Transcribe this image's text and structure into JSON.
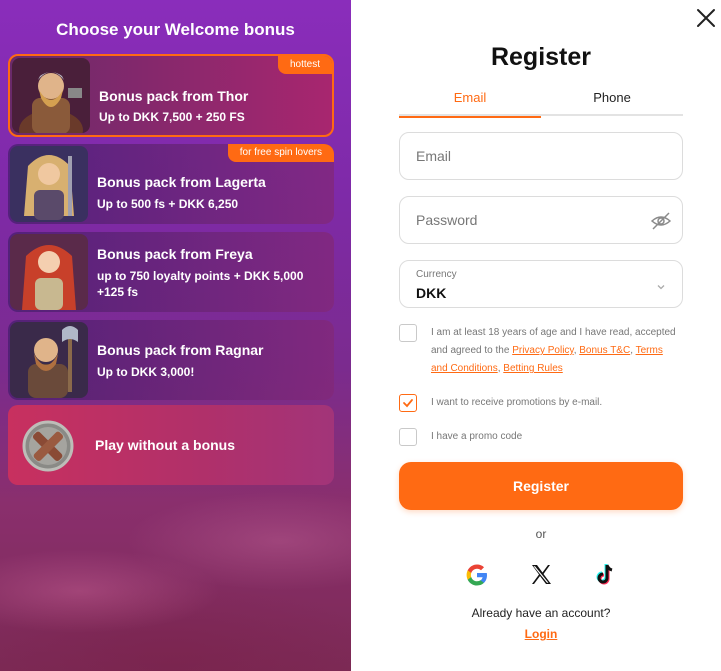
{
  "left": {
    "title": "Choose your Welcome bonus",
    "bonuses": [
      {
        "title": "Bonus pack from Thor",
        "subtitle": "Up to DKK 7,500 + 250 FS",
        "badge": "hottest",
        "selected": true
      },
      {
        "title": "Bonus pack from Lagerta",
        "subtitle": "Up to 500 fs + DKK 6,250",
        "badge": "for free spin lovers"
      },
      {
        "title": "Bonus pack from Freya",
        "subtitle": "up to 750 loyalty points + DKK 5,000 +125 fs"
      },
      {
        "title": "Bonus pack from Ragnar",
        "subtitle": "Up to DKK 3,000!"
      }
    ],
    "no_bonus_label": "Play without a bonus"
  },
  "register": {
    "title": "Register",
    "tabs": [
      {
        "label": "Email",
        "active": true
      },
      {
        "label": "Phone",
        "active": false
      }
    ],
    "email_placeholder": "Email",
    "password_placeholder": "Password",
    "currency_label": "Currency",
    "currency_value": "DKK",
    "age_text": "I am at least 18 years of age and I have read, accepted and agreed to the",
    "links": {
      "privacy": "Privacy Policy",
      "bonus": "Bonus T&C",
      "terms": "Terms and Conditions",
      "betting": "Betting Rules"
    },
    "age_checked": false,
    "promotions_text": "I want to receive promotions by e-mail.",
    "promotions_checked": true,
    "promo_code_text": "I have a promo code",
    "promo_code_checked": false,
    "button_label": "Register",
    "or_text": "or",
    "social": [
      "google-icon",
      "x-icon",
      "tiktok-icon"
    ],
    "have_account_text": "Already have an account?",
    "login_label": "Login"
  },
  "colors": {
    "accent": "#ff6a13",
    "panel_purple": "#7e2aa7",
    "nobonus_pink": "#c8305f"
  }
}
